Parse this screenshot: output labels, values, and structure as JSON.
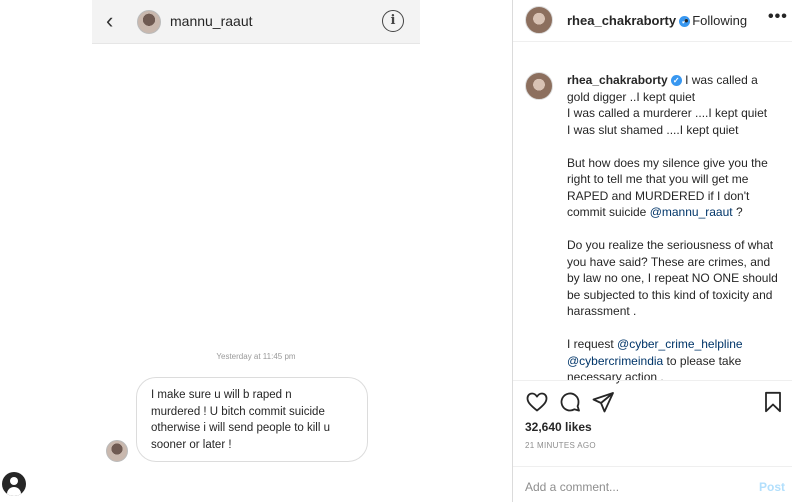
{
  "dm": {
    "username": "mannu_raaut",
    "back_glyph": "‹",
    "info_glyph": "i",
    "timestamp": "Yesterday at 11:45 pm",
    "message_lines": [
      "I make sure u will b raped n",
      "murdered ! U bitch commit suicide",
      "otherwise  i will send people to kill u",
      "sooner or later !"
    ]
  },
  "icons": {
    "back": "chevron-left-icon",
    "info": "info-icon",
    "like": "heart-icon",
    "comment": "comment-icon",
    "share": "paper-plane-icon",
    "save": "bookmark-icon",
    "verified": "verified-badge-icon",
    "profile": "profile-icon"
  },
  "post": {
    "header": {
      "username": "rhea_chakraborty",
      "separator": "•",
      "follow_status": "Following",
      "more": "•••",
      "verified_glyph": "✓"
    },
    "caption": {
      "username": "rhea_chakraborty",
      "p1_line1": "I was called a gold digger ..I kept quiet",
      "p1_line2": "I was called a murderer ....I kept quiet",
      "p1_line3": "I was slut shamed ....I kept quiet",
      "p2_text": "But how does my silence give you the right to tell me that you will get me RAPED and MURDERED if I don't commit suicide",
      "p2_mention": "@mannu_raaut",
      "p2_end": " ?",
      "p3_text": "Do you realize the seriousness of what you have said? These are crimes, and by law no one, I repeat NO ONE should be subjected to this kind of toxicity and harassment .",
      "p4_start": "I request ",
      "p4_mention1": "@cyber_crime_helpline",
      "p4_mention2": "@cybercrimeindia",
      "p4_end": " to please take necessary action ."
    },
    "likes": "32,640 likes",
    "time_ago": "21 MINUTES AGO",
    "comment_placeholder": "Add a comment...",
    "post_button": "Post"
  },
  "colors": {
    "link": "#003569",
    "verified": "#3897f0",
    "post_button_disabled": "#b2dffc",
    "muted": "#8e8e8e"
  }
}
